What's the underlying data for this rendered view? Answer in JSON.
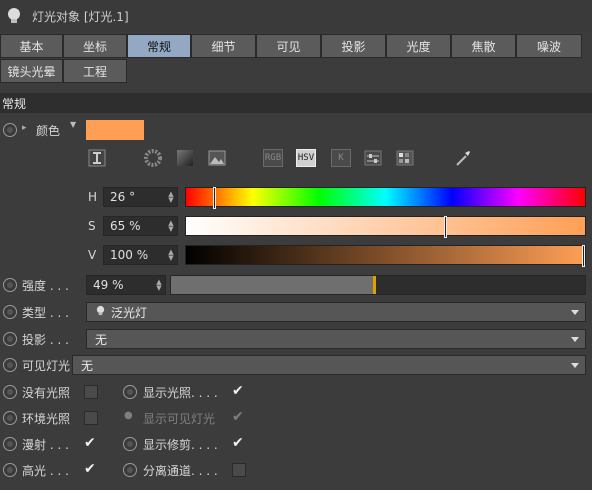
{
  "window": {
    "title": "灯光对象 [灯光.1]"
  },
  "tabs": [
    {
      "label": "基本",
      "active": false
    },
    {
      "label": "坐标",
      "active": false
    },
    {
      "label": "常规",
      "active": true
    },
    {
      "label": "细节",
      "active": false
    },
    {
      "label": "可见",
      "active": false
    },
    {
      "label": "投影",
      "active": false
    },
    {
      "label": "光度",
      "active": false
    },
    {
      "label": "焦散",
      "active": false
    },
    {
      "label": "噪波",
      "active": false
    },
    {
      "label": "镜头光晕",
      "active": false
    },
    {
      "label": "工程",
      "active": false
    }
  ],
  "section": {
    "title": "常规"
  },
  "color": {
    "label": "颜色",
    "swatch": "#ff9f55",
    "tool_tags": [
      "RGB",
      "HSV",
      "K"
    ],
    "hsv": {
      "h": {
        "letter": "H",
        "value": "26 °",
        "fraction": 0.07
      },
      "s": {
        "letter": "S",
        "value": "65 %",
        "fraction": 0.65
      },
      "v": {
        "letter": "V",
        "value": "100 %",
        "fraction": 1.0
      }
    }
  },
  "intensity": {
    "label": "强度 . . .",
    "value": "49 %",
    "fraction": 0.49
  },
  "type": {
    "label": "类型 . . .",
    "value": "泛光灯"
  },
  "shadow": {
    "label": "投影 . . .",
    "value": "无"
  },
  "visible_light": {
    "label": "可见灯光",
    "value": "无"
  },
  "checkboxes": {
    "no_illum": {
      "label": "没有光照"
    },
    "show_illum": {
      "label": "显示光照. . . .",
      "checked": true
    },
    "ambient": {
      "label": "环境光照"
    },
    "show_visible": {
      "label": "显示可见灯光",
      "checked": true
    },
    "diffuse": {
      "label": "漫射 . . .",
      "checked": true
    },
    "show_clip": {
      "label": "显示修剪. . . .",
      "checked": true
    },
    "specular": {
      "label": "高光 . . .",
      "checked": true
    },
    "separate_pass": {
      "label": "分离通道. . . .",
      "checked": false
    }
  }
}
